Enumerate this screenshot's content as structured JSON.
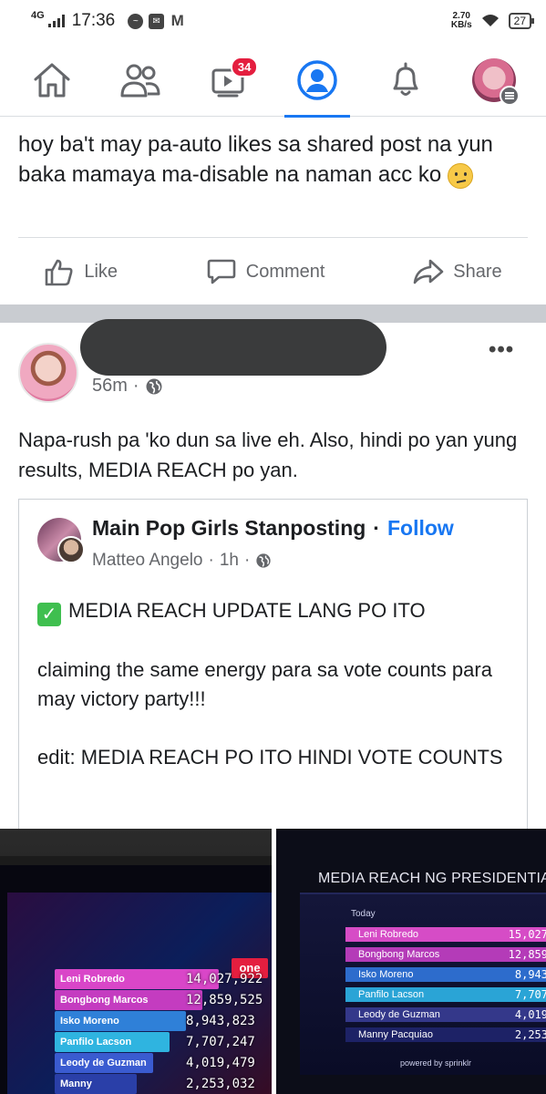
{
  "status_bar": {
    "network": "4G",
    "time": "17:36",
    "speed_value": "2.70",
    "speed_unit": "KB/s",
    "battery": "27"
  },
  "nav": {
    "video_badge": "34",
    "items": [
      "home-icon",
      "friends-icon",
      "watch-icon",
      "profile-icon",
      "notifications-icon",
      "menu-avatar"
    ]
  },
  "post1": {
    "text": "hoy ba't may pa-auto likes sa shared post na yun baka mamaya ma-disable na naman acc ko",
    "actions": {
      "like": "Like",
      "comment": "Comment",
      "share": "Share"
    }
  },
  "post2": {
    "time": "56m",
    "text": "Napa-rush pa 'ko dun sa live eh. Also, hindi po yan yung results, MEDIA REACH po yan.",
    "shared": {
      "page_name": "Main Pop Girls Stanposting",
      "follow": "Follow",
      "author": "Matteo Angelo",
      "time": "1h",
      "line1": "MEDIA REACH UPDATE LANG PO ITO",
      "line2": "claiming the same energy para sa vote counts para may victory party!!!",
      "line3": "edit: MEDIA REACH PO ITO HINDI VOTE COUNTS"
    },
    "photo_left": {
      "logo": "one",
      "rows": [
        {
          "name": "Leni Robredo",
          "value": "14,027,922",
          "color": "#d946c8"
        },
        {
          "name": "Bongbong Marcos",
          "value": "12,859,525",
          "color": "#c43cc0"
        },
        {
          "name": "Isko Moreno",
          "value": "8,943,823",
          "color": "#2f80d8"
        },
        {
          "name": "Panfilo Lacson",
          "value": "7,707,247",
          "color": "#2fb4e0"
        },
        {
          "name": "Leody de Guzman",
          "value": "4,019,479",
          "color": "#3a5bd0"
        },
        {
          "name": "Manny Pacquiao",
          "value": "2,253,032",
          "color": "#2a3fa8"
        }
      ]
    },
    "photo_right": {
      "title": "MEDIA REACH NG PRESIDENTIAB",
      "label": "Today",
      "rows": [
        {
          "name": "Leni Robredo",
          "value": "15,027",
          "color": "#d64cc6"
        },
        {
          "name": "Bongbong Marcos",
          "value": "12,859",
          "color": "#b43bb8"
        },
        {
          "name": "Isko Moreno",
          "value": "8,943",
          "color": "#2d6ccc"
        },
        {
          "name": "Panfilo Lacson",
          "value": "7,707",
          "color": "#2aa4d6"
        },
        {
          "name": "Leody de Guzman",
          "value": "4,019",
          "color": "#34388a"
        },
        {
          "name": "Manny Pacquiao",
          "value": "2,253",
          "color": "#1d2266"
        }
      ],
      "footer": "powered by sprinklr"
    }
  }
}
